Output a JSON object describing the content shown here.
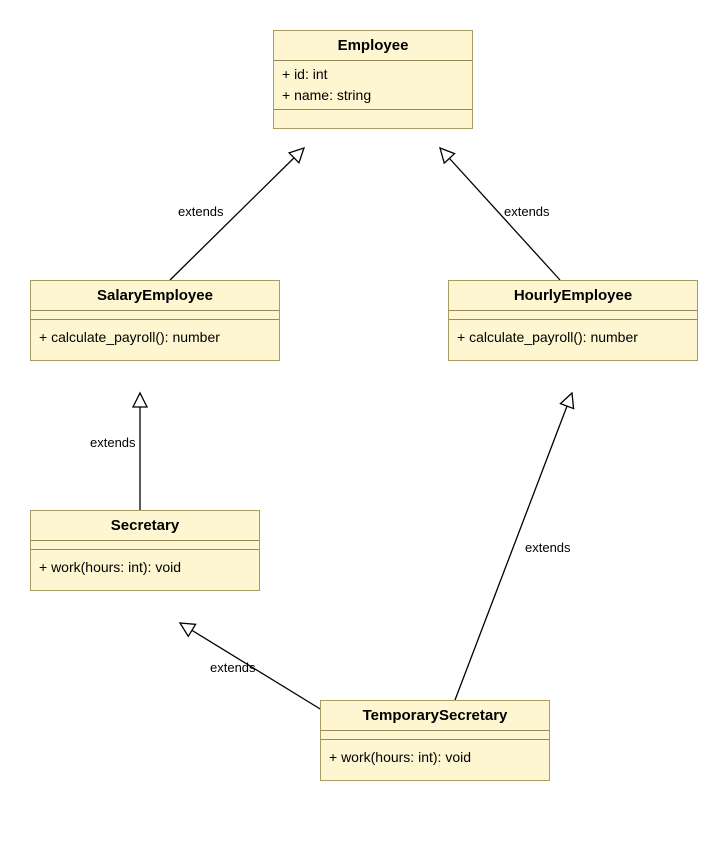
{
  "classes": {
    "employee": {
      "name": "Employee",
      "attrs": [
        "+ id: int",
        "+ name: string"
      ],
      "methods": []
    },
    "salaryEmployee": {
      "name": "SalaryEmployee",
      "attrs": [],
      "methods": [
        "+ calculate_payroll(): number"
      ]
    },
    "hourlyEmployee": {
      "name": "HourlyEmployee",
      "attrs": [],
      "methods": [
        "+ calculate_payroll(): number"
      ]
    },
    "secretary": {
      "name": "Secretary",
      "attrs": [],
      "methods": [
        "+ work(hours: int): void"
      ]
    },
    "temporarySecretary": {
      "name": "TemporarySecretary",
      "attrs": [],
      "methods": [
        "+ work(hours: int): void"
      ]
    }
  },
  "labels": {
    "extends1": "extends",
    "extends2": "extends",
    "extends3": "extends",
    "extends4": "extends",
    "extends5": "extends"
  }
}
